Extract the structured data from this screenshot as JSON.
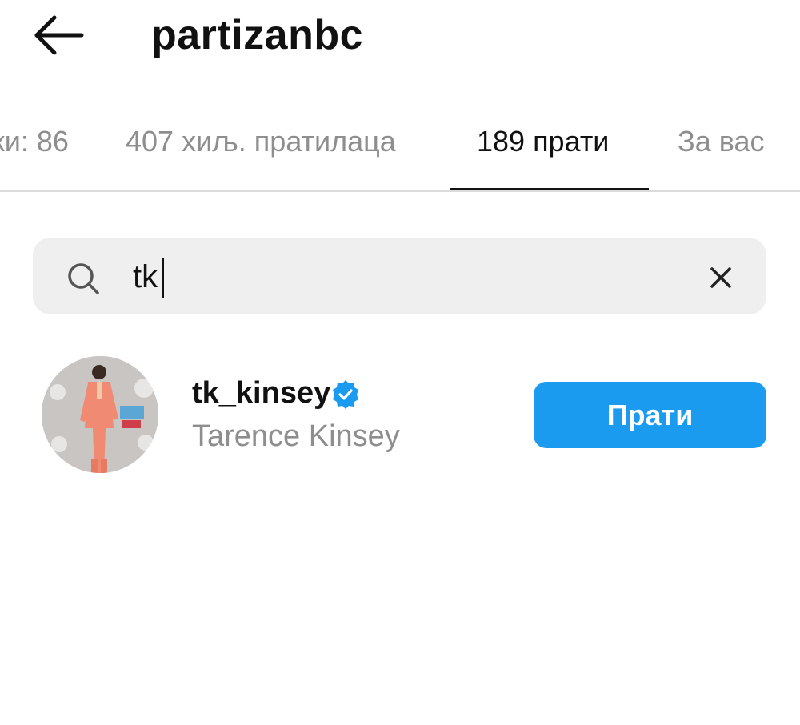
{
  "header": {
    "title": "partizanbc",
    "back_icon": "arrow-left-icon"
  },
  "tabs": [
    {
      "label": "ки: 86",
      "active": false
    },
    {
      "label": "407 хиљ. пратилаца",
      "active": false
    },
    {
      "label": "189 прати",
      "active": true
    },
    {
      "label": "За вас",
      "active": false
    }
  ],
  "search": {
    "value": "tk",
    "search_icon": "search-icon",
    "clear_icon": "close-icon"
  },
  "results": [
    {
      "username": "tk_kinsey",
      "verified": true,
      "full_name": "Tarence Kinsey",
      "follow_label": "Прати"
    }
  ],
  "colors": {
    "primary_button": "#1a9bf0",
    "verified_badge": "#1a9bf0",
    "muted_text": "#8e8e8e",
    "search_bg": "#efefef"
  }
}
